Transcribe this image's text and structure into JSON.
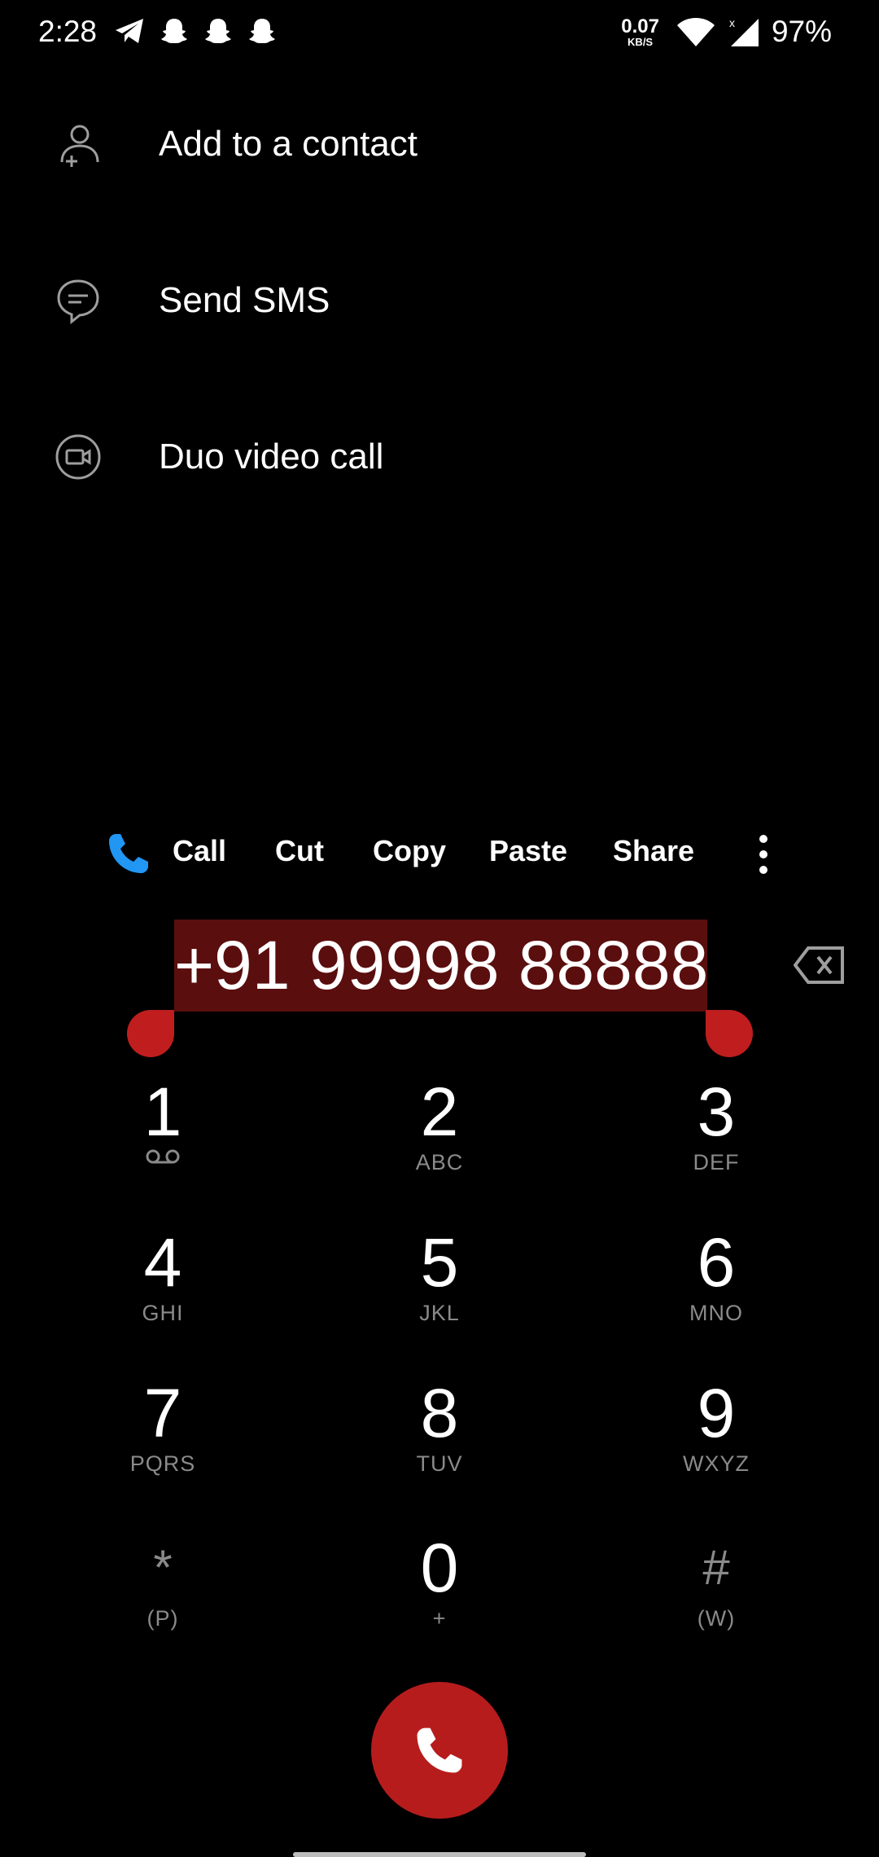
{
  "status_bar": {
    "time": "2:28",
    "speed_value": "0.07",
    "speed_unit": "KB/S",
    "battery": "97%",
    "notification_icons": [
      "telegram-icon",
      "snapchat-icon",
      "snapchat-icon",
      "snapchat-icon"
    ]
  },
  "actions": [
    {
      "label": "Add to a contact",
      "icon": "add-contact-icon"
    },
    {
      "label": "Send SMS",
      "icon": "sms-icon"
    },
    {
      "label": "Duo video call",
      "icon": "video-call-icon"
    }
  ],
  "toolbar": {
    "call": "Call",
    "cut": "Cut",
    "copy": "Copy",
    "paste": "Paste",
    "share": "Share"
  },
  "dialer": {
    "number": "+91 99998 88888"
  },
  "keypad": [
    {
      "digit": "1",
      "sub": ""
    },
    {
      "digit": "2",
      "sub": "ABC"
    },
    {
      "digit": "3",
      "sub": "DEF"
    },
    {
      "digit": "4",
      "sub": "GHI"
    },
    {
      "digit": "5",
      "sub": "JKL"
    },
    {
      "digit": "6",
      "sub": "MNO"
    },
    {
      "digit": "7",
      "sub": "PQRS"
    },
    {
      "digit": "8",
      "sub": "TUV"
    },
    {
      "digit": "9",
      "sub": "WXYZ"
    },
    {
      "digit": "*",
      "sub": "(P)"
    },
    {
      "digit": "0",
      "sub": "+"
    },
    {
      "digit": "#",
      "sub": "(W)"
    }
  ],
  "colors": {
    "accent_red": "#b71c1c",
    "selection_bg": "#5a0e0e",
    "call_icon_blue": "#2196f3"
  }
}
